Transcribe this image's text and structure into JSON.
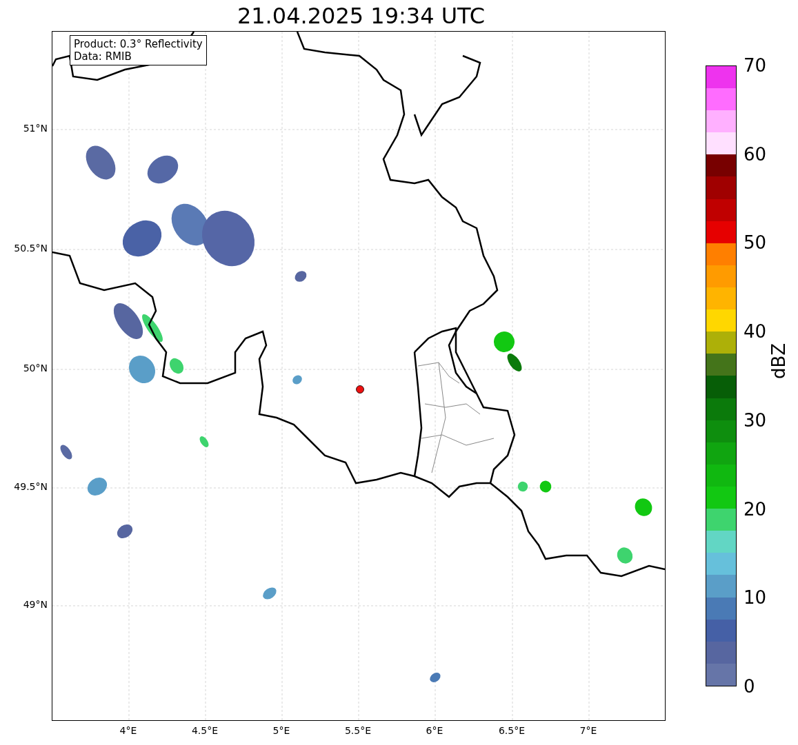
{
  "title": "21.04.2025 19:34 UTC",
  "annotation": {
    "lines": [
      "Product: 0.3° Reflectivity",
      "Data: RMIB"
    ]
  },
  "map": {
    "yticks": [
      "51°N",
      "50.5°N",
      "50°N",
      "49.5°N",
      "49°N"
    ],
    "xticks": [
      "4°E",
      "4.5°E",
      "5°E",
      "5.5°E",
      "6°E",
      "6.5°E",
      "7°E"
    ]
  },
  "colorbar": {
    "label": "dBZ",
    "ticks": [
      "70",
      "60",
      "50",
      "40",
      "30",
      "20",
      "10",
      "0"
    ],
    "bands": [
      {
        "color": "#6675a8"
      },
      {
        "color": "#5766a0"
      },
      {
        "color": "#4560a6"
      },
      {
        "color": "#4a7ab5"
      },
      {
        "color": "#5a9ec8"
      },
      {
        "color": "#66c0db"
      },
      {
        "color": "#62d6c4"
      },
      {
        "color": "#3ed46e"
      },
      {
        "color": "#12c812"
      },
      {
        "color": "#10b810"
      },
      {
        "color": "#10a510"
      },
      {
        "color": "#0e8e0e"
      },
      {
        "color": "#0b7a0b"
      },
      {
        "color": "#075e07"
      },
      {
        "color": "#44741a"
      },
      {
        "color": "#adb008"
      },
      {
        "color": "#ffd700"
      },
      {
        "color": "#ffb400"
      },
      {
        "color": "#ff9b00"
      },
      {
        "color": "#ff7f00"
      },
      {
        "color": "#e60000"
      },
      {
        "color": "#c00000"
      },
      {
        "color": "#a00000"
      },
      {
        "color": "#780000"
      },
      {
        "color": "#ffe0ff"
      },
      {
        "color": "#ffb0ff"
      },
      {
        "color": "#ff6cff"
      },
      {
        "color": "#ee33ee"
      }
    ]
  }
}
